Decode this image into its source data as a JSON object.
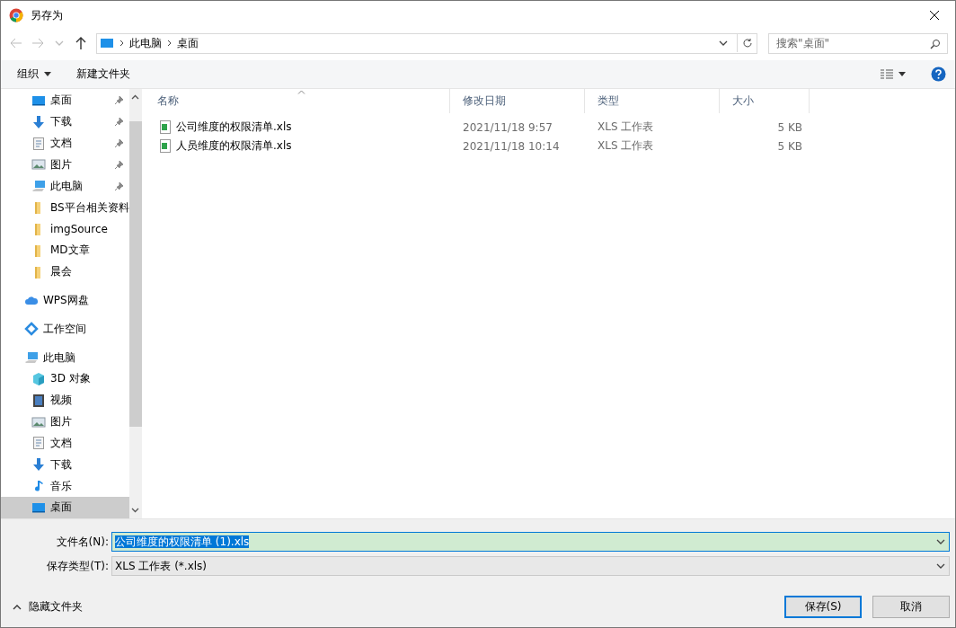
{
  "window": {
    "title": "另存为"
  },
  "address": {
    "path": [
      "此电脑",
      "桌面"
    ]
  },
  "search": {
    "placeholder": "搜索\"桌面\""
  },
  "toolbar": {
    "organize": "组织",
    "new_folder": "新建文件夹"
  },
  "quick_access": [
    {
      "label": "桌面",
      "kind": "desktop",
      "pinned": true,
      "selected": false
    },
    {
      "label": "下载",
      "kind": "download",
      "pinned": true,
      "selected": false
    },
    {
      "label": "文档",
      "kind": "document",
      "pinned": true,
      "selected": false
    },
    {
      "label": "图片",
      "kind": "picture",
      "pinned": true,
      "selected": false
    },
    {
      "label": "此电脑",
      "kind": "pc",
      "pinned": true,
      "selected": false
    },
    {
      "label": "BS平台相关资料",
      "kind": "folder",
      "pinned": false,
      "selected": false
    },
    {
      "label": "imgSource",
      "kind": "folder",
      "pinned": false,
      "selected": false
    },
    {
      "label": "MD文章",
      "kind": "folder",
      "pinned": false,
      "selected": false
    },
    {
      "label": "晨会",
      "kind": "folder",
      "pinned": false,
      "selected": false
    }
  ],
  "sidebar": {
    "items": [
      {
        "label": "WPS网盘",
        "kind": "cloud",
        "selected": false
      },
      {
        "label": "工作空间",
        "kind": "workspace",
        "selected": false
      },
      {
        "label": "此电脑",
        "kind": "pc",
        "selected": false,
        "children": [
          {
            "label": "3D 对象",
            "kind": "cube",
            "selected": false
          },
          {
            "label": "视频",
            "kind": "video",
            "selected": false
          },
          {
            "label": "图片",
            "kind": "picture",
            "selected": false
          },
          {
            "label": "文档",
            "kind": "document",
            "selected": false
          },
          {
            "label": "下载",
            "kind": "download",
            "selected": false
          },
          {
            "label": "音乐",
            "kind": "music",
            "selected": false
          },
          {
            "label": "桌面",
            "kind": "desktop",
            "selected": true
          }
        ]
      }
    ]
  },
  "table": {
    "columns": [
      "名称",
      "修改日期",
      "类型",
      "大小"
    ],
    "rows": [
      {
        "name": "公司维度的权限清单.xls",
        "modified": "2021/11/18 9:57",
        "type": "XLS 工作表",
        "size": "5 KB"
      },
      {
        "name": "人员维度的权限清单.xls",
        "modified": "2021/11/18 10:14",
        "type": "XLS 工作表",
        "size": "5 KB"
      }
    ]
  },
  "filename": {
    "label": "文件名(N):",
    "value": "公司维度的权限清单 (1).xls",
    "selected": true
  },
  "filetype": {
    "label": "保存类型(T):",
    "value": "XLS 工作表 (*.xls)"
  },
  "hide_folders": "隐藏文件夹",
  "buttons": [
    {
      "label": "保存(S)",
      "primary": true
    },
    {
      "label": "取消",
      "primary": false
    }
  ]
}
